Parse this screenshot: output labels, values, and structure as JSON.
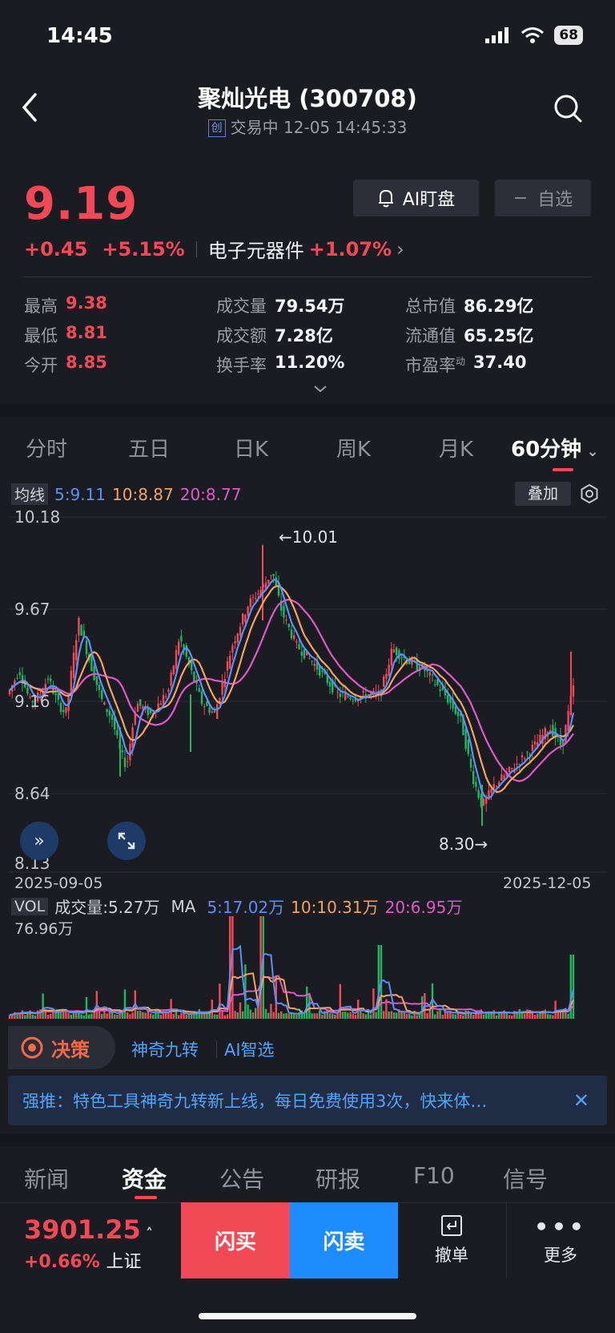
{
  "status": {
    "time": "14:45",
    "battery": "68"
  },
  "header": {
    "title": "聚灿光电 (300708)",
    "board": "创",
    "state": "交易中",
    "datetime": "12-05 14:45:33"
  },
  "quote": {
    "price": "9.19",
    "change": "+0.45",
    "change_pct": "+5.15%",
    "sector": "电子元器件",
    "sector_pct": "+1.07%",
    "ai_label": "AI盯盘",
    "watch_label": "自选"
  },
  "stats": [
    {
      "label": "最高",
      "value": "9.38"
    },
    {
      "label": "最低",
      "value": "8.81"
    },
    {
      "label": "今开",
      "value": "8.85"
    },
    {
      "label": "成交量",
      "value": "79.54万"
    },
    {
      "label": "成交额",
      "value": "7.28亿"
    },
    {
      "label": "换手率",
      "value": "11.20%"
    },
    {
      "label": "总市值",
      "value": "86.29亿"
    },
    {
      "label": "流通值",
      "value": "65.25亿"
    },
    {
      "label": "市盈率",
      "sup": "动",
      "value": "37.40"
    }
  ],
  "period_tabs": [
    "分时",
    "五日",
    "日K",
    "周K",
    "月K",
    "60分钟"
  ],
  "chart": {
    "ma_tag": "均线",
    "ma5": "5:9.11",
    "ma10": "10:8.87",
    "ma20": "20:8.77",
    "overlay": "叠加",
    "y_ticks": [
      "10.18",
      "9.67",
      "9.16",
      "8.64",
      "8.13"
    ],
    "x_start": "2025-09-05",
    "x_end": "2025-12-05",
    "high_note": "←10.01",
    "low_note": "8.30→",
    "colors": {
      "up": "#f24957",
      "down": "#1fb760",
      "ma5": "#5b8ff9",
      "ma10": "#f5a35a",
      "ma20": "#e058c8"
    }
  },
  "volume": {
    "tag": "VOL",
    "vol": "成交量:5.27万",
    "ma": "MA",
    "ma5": "5:17.02万",
    "ma10": "10:10.31万",
    "ma20": "20:6.95万",
    "max": "76.96万"
  },
  "tools": {
    "juece": "决策",
    "link1": "神奇九转",
    "link2": "AI智选"
  },
  "promo": {
    "text": "强推：特色工具神奇九转新上线，每日免费使用3次，快来体…",
    "close": "✕"
  },
  "news_tabs": [
    "新闻",
    "资金",
    "公告",
    "研报",
    "F10",
    "信号"
  ],
  "bottom": {
    "index_value": "3901.25",
    "index_change": "+0.66%",
    "index_name": "上证",
    "buy": "闪买",
    "sell": "闪卖",
    "cancel": "撤单",
    "more": "更多"
  }
}
